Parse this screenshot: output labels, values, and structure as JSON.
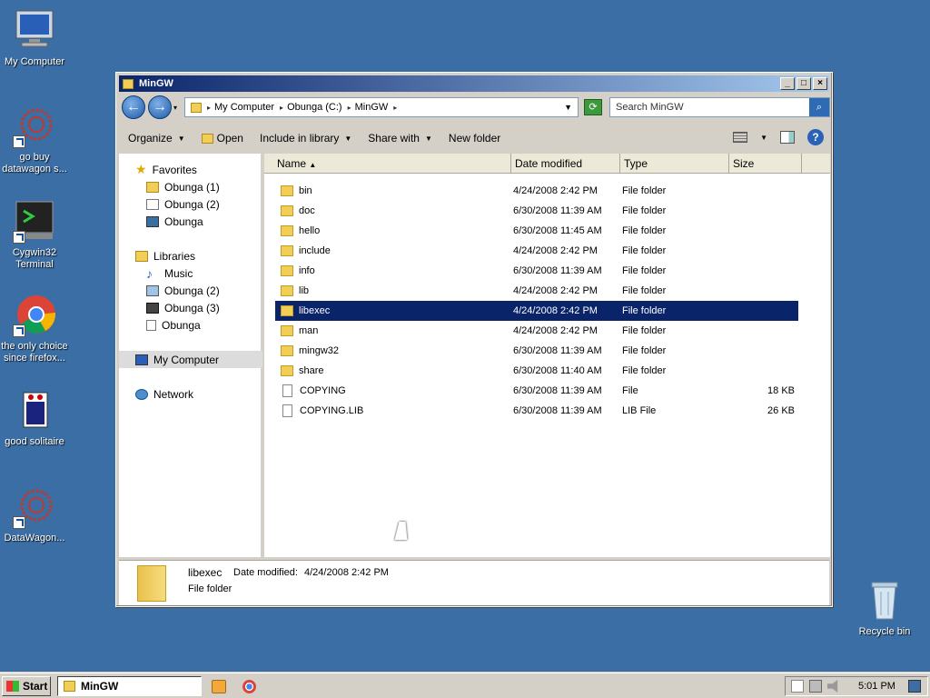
{
  "desktop_icons": [
    {
      "name": "my-computer",
      "label": "My Computer",
      "icon": "computer-icon"
    },
    {
      "name": "go-buy-datawagon",
      "label": "go buy datawagon s...",
      "icon": "datawagon-icon"
    },
    {
      "name": "cygwin32-terminal",
      "label": "Cygwin32 Terminal",
      "icon": "terminal-icon"
    },
    {
      "name": "chrome",
      "label": "the only choice since firefox...",
      "icon": "chrome-icon"
    },
    {
      "name": "good-solitaire",
      "label": "good solitaire",
      "icon": "solitaire-icon"
    },
    {
      "name": "datawagon",
      "label": "DataWagon...",
      "icon": "datawagon-icon"
    },
    {
      "name": "recycle-bin",
      "label": "Recycle bin",
      "icon": "recycle-bin-icon"
    }
  ],
  "window": {
    "title": "MinGW",
    "breadcrumbs": [
      "My Computer",
      "Obunga (C:)",
      "MinGW"
    ],
    "search_placeholder": "Search MinGW"
  },
  "toolbar": {
    "organize": "Organize",
    "open": "Open",
    "include_in_library": "Include in library",
    "share_with": "Share with",
    "new_folder": "New folder"
  },
  "nav": {
    "favorites": "Favorites",
    "favorites_items": [
      "Obunga (1)",
      "Obunga (2)",
      "Obunga"
    ],
    "libraries": "Libraries",
    "libraries_items": [
      "Music",
      "Obunga (2)",
      "Obunga (3)",
      "Obunga"
    ],
    "my_computer": "My Computer",
    "network": "Network"
  },
  "columns": {
    "name": "Name",
    "date": "Date modified",
    "type": "Type",
    "size": "Size"
  },
  "files": [
    {
      "name": "bin",
      "date": "4/24/2008 2:42 PM",
      "type": "File folder",
      "size": "",
      "kind": "folder"
    },
    {
      "name": "doc",
      "date": "6/30/2008 11:39 AM",
      "type": "File folder",
      "size": "",
      "kind": "folder"
    },
    {
      "name": "hello",
      "date": "6/30/2008 11:45 AM",
      "type": "File folder",
      "size": "",
      "kind": "folder"
    },
    {
      "name": "include",
      "date": "4/24/2008 2:42 PM",
      "type": "File folder",
      "size": "",
      "kind": "folder"
    },
    {
      "name": "info",
      "date": "6/30/2008 11:39 AM",
      "type": "File folder",
      "size": "",
      "kind": "folder"
    },
    {
      "name": "lib",
      "date": "4/24/2008 2:42 PM",
      "type": "File folder",
      "size": "",
      "kind": "folder"
    },
    {
      "name": "libexec",
      "date": "4/24/2008 2:42 PM",
      "type": "File folder",
      "size": "",
      "kind": "folder",
      "selected": true
    },
    {
      "name": "man",
      "date": "4/24/2008 2:42 PM",
      "type": "File folder",
      "size": "",
      "kind": "folder"
    },
    {
      "name": "mingw32",
      "date": "6/30/2008 11:39 AM",
      "type": "File folder",
      "size": "",
      "kind": "folder"
    },
    {
      "name": "share",
      "date": "6/30/2008 11:40 AM",
      "type": "File folder",
      "size": "",
      "kind": "folder"
    },
    {
      "name": "COPYING",
      "date": "6/30/2008 11:39 AM",
      "type": "File",
      "size": "18 KB",
      "kind": "file"
    },
    {
      "name": "COPYING.LIB",
      "date": "6/30/2008 11:39 AM",
      "type": "LIB File",
      "size": "26 KB",
      "kind": "file"
    }
  ],
  "details": {
    "name": "libexec",
    "date_label": "Date modified:",
    "date": "4/24/2008 2:42 PM",
    "type": "File folder"
  },
  "taskbar": {
    "start": "Start",
    "task": "MinGW",
    "clock": "5:01 PM"
  },
  "colors": {
    "desktop": "#3a6ea5",
    "selection": "#0a246a",
    "title_start": "#0a246a",
    "title_end": "#a6caf0"
  }
}
